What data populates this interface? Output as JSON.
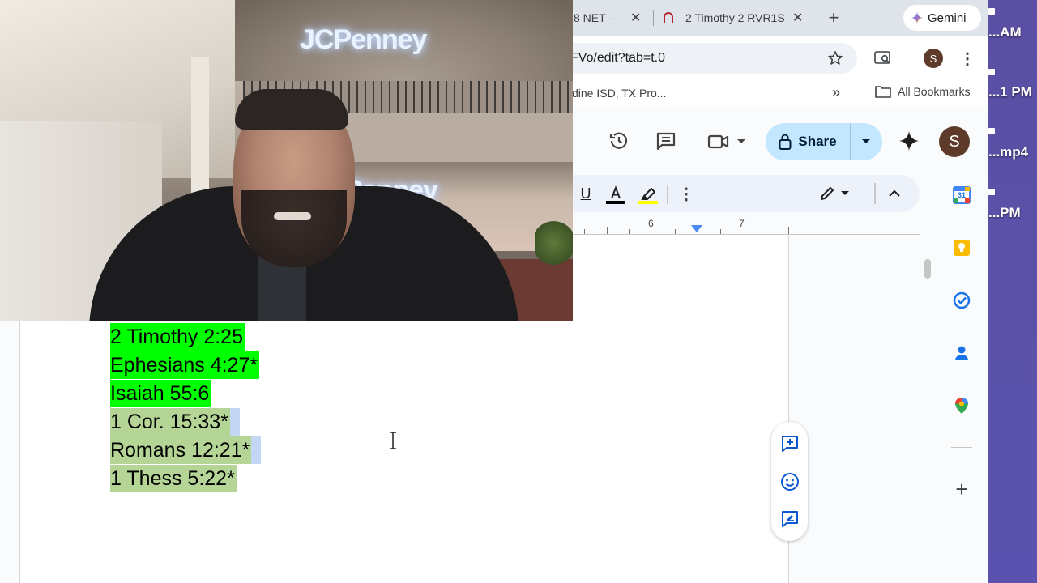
{
  "browser": {
    "tabs": [
      {
        "label": "8 NET -"
      },
      {
        "label": "2 Timothy 2 RVR1S"
      }
    ],
    "gemini_label": "Gemini",
    "url": "FVo/edit?tab=t.0",
    "profile_initial": "S",
    "bookmarks": {
      "item": "dine ISD, TX Pro...",
      "all_bookmarks": "All Bookmarks"
    }
  },
  "docs": {
    "share_label": "Share",
    "user_initial": "S",
    "ruler": {
      "marks": [
        "6",
        "7"
      ]
    },
    "verses": [
      {
        "text": "2 Timothy 2:25",
        "highlight": "green"
      },
      {
        "text": "Ephesians 4:27*",
        "highlight": "green"
      },
      {
        "text": "Isaiah 55:6",
        "highlight": "green"
      },
      {
        "text": "1 Cor. 15:33*",
        "highlight": "selected"
      },
      {
        "text": "Romans 12:21*",
        "highlight": "selected"
      },
      {
        "text": "1 Thess 5:22*",
        "highlight": "selected"
      }
    ],
    "calendar_day": "31"
  },
  "webcam": {
    "sign_top": "JCPenney",
    "sign_bottom": "Penney"
  },
  "desktop": {
    "items": [
      "...AM",
      "...1 PM",
      "...mp4",
      "...PM"
    ]
  },
  "colors": {
    "highlight_green": "#00ff00",
    "selection_green": "#b4d596",
    "share_bg": "#c2e7ff"
  }
}
